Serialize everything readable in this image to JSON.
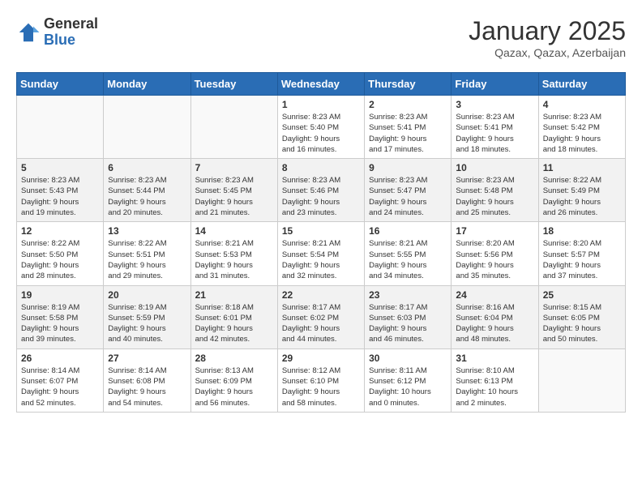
{
  "header": {
    "logo_general": "General",
    "logo_blue": "Blue",
    "month_title": "January 2025",
    "location": "Qazax, Qazax, Azerbaijan"
  },
  "days_of_week": [
    "Sunday",
    "Monday",
    "Tuesday",
    "Wednesday",
    "Thursday",
    "Friday",
    "Saturday"
  ],
  "weeks": [
    [
      {
        "day": "",
        "info": ""
      },
      {
        "day": "",
        "info": ""
      },
      {
        "day": "",
        "info": ""
      },
      {
        "day": "1",
        "info": "Sunrise: 8:23 AM\nSunset: 5:40 PM\nDaylight: 9 hours\nand 16 minutes."
      },
      {
        "day": "2",
        "info": "Sunrise: 8:23 AM\nSunset: 5:41 PM\nDaylight: 9 hours\nand 17 minutes."
      },
      {
        "day": "3",
        "info": "Sunrise: 8:23 AM\nSunset: 5:41 PM\nDaylight: 9 hours\nand 18 minutes."
      },
      {
        "day": "4",
        "info": "Sunrise: 8:23 AM\nSunset: 5:42 PM\nDaylight: 9 hours\nand 18 minutes."
      }
    ],
    [
      {
        "day": "5",
        "info": "Sunrise: 8:23 AM\nSunset: 5:43 PM\nDaylight: 9 hours\nand 19 minutes."
      },
      {
        "day": "6",
        "info": "Sunrise: 8:23 AM\nSunset: 5:44 PM\nDaylight: 9 hours\nand 20 minutes."
      },
      {
        "day": "7",
        "info": "Sunrise: 8:23 AM\nSunset: 5:45 PM\nDaylight: 9 hours\nand 21 minutes."
      },
      {
        "day": "8",
        "info": "Sunrise: 8:23 AM\nSunset: 5:46 PM\nDaylight: 9 hours\nand 23 minutes."
      },
      {
        "day": "9",
        "info": "Sunrise: 8:23 AM\nSunset: 5:47 PM\nDaylight: 9 hours\nand 24 minutes."
      },
      {
        "day": "10",
        "info": "Sunrise: 8:23 AM\nSunset: 5:48 PM\nDaylight: 9 hours\nand 25 minutes."
      },
      {
        "day": "11",
        "info": "Sunrise: 8:22 AM\nSunset: 5:49 PM\nDaylight: 9 hours\nand 26 minutes."
      }
    ],
    [
      {
        "day": "12",
        "info": "Sunrise: 8:22 AM\nSunset: 5:50 PM\nDaylight: 9 hours\nand 28 minutes."
      },
      {
        "day": "13",
        "info": "Sunrise: 8:22 AM\nSunset: 5:51 PM\nDaylight: 9 hours\nand 29 minutes."
      },
      {
        "day": "14",
        "info": "Sunrise: 8:21 AM\nSunset: 5:53 PM\nDaylight: 9 hours\nand 31 minutes."
      },
      {
        "day": "15",
        "info": "Sunrise: 8:21 AM\nSunset: 5:54 PM\nDaylight: 9 hours\nand 32 minutes."
      },
      {
        "day": "16",
        "info": "Sunrise: 8:21 AM\nSunset: 5:55 PM\nDaylight: 9 hours\nand 34 minutes."
      },
      {
        "day": "17",
        "info": "Sunrise: 8:20 AM\nSunset: 5:56 PM\nDaylight: 9 hours\nand 35 minutes."
      },
      {
        "day": "18",
        "info": "Sunrise: 8:20 AM\nSunset: 5:57 PM\nDaylight: 9 hours\nand 37 minutes."
      }
    ],
    [
      {
        "day": "19",
        "info": "Sunrise: 8:19 AM\nSunset: 5:58 PM\nDaylight: 9 hours\nand 39 minutes."
      },
      {
        "day": "20",
        "info": "Sunrise: 8:19 AM\nSunset: 5:59 PM\nDaylight: 9 hours\nand 40 minutes."
      },
      {
        "day": "21",
        "info": "Sunrise: 8:18 AM\nSunset: 6:01 PM\nDaylight: 9 hours\nand 42 minutes."
      },
      {
        "day": "22",
        "info": "Sunrise: 8:17 AM\nSunset: 6:02 PM\nDaylight: 9 hours\nand 44 minutes."
      },
      {
        "day": "23",
        "info": "Sunrise: 8:17 AM\nSunset: 6:03 PM\nDaylight: 9 hours\nand 46 minutes."
      },
      {
        "day": "24",
        "info": "Sunrise: 8:16 AM\nSunset: 6:04 PM\nDaylight: 9 hours\nand 48 minutes."
      },
      {
        "day": "25",
        "info": "Sunrise: 8:15 AM\nSunset: 6:05 PM\nDaylight: 9 hours\nand 50 minutes."
      }
    ],
    [
      {
        "day": "26",
        "info": "Sunrise: 8:14 AM\nSunset: 6:07 PM\nDaylight: 9 hours\nand 52 minutes."
      },
      {
        "day": "27",
        "info": "Sunrise: 8:14 AM\nSunset: 6:08 PM\nDaylight: 9 hours\nand 54 minutes."
      },
      {
        "day": "28",
        "info": "Sunrise: 8:13 AM\nSunset: 6:09 PM\nDaylight: 9 hours\nand 56 minutes."
      },
      {
        "day": "29",
        "info": "Sunrise: 8:12 AM\nSunset: 6:10 PM\nDaylight: 9 hours\nand 58 minutes."
      },
      {
        "day": "30",
        "info": "Sunrise: 8:11 AM\nSunset: 6:12 PM\nDaylight: 10 hours\nand 0 minutes."
      },
      {
        "day": "31",
        "info": "Sunrise: 8:10 AM\nSunset: 6:13 PM\nDaylight: 10 hours\nand 2 minutes."
      },
      {
        "day": "",
        "info": ""
      }
    ]
  ]
}
